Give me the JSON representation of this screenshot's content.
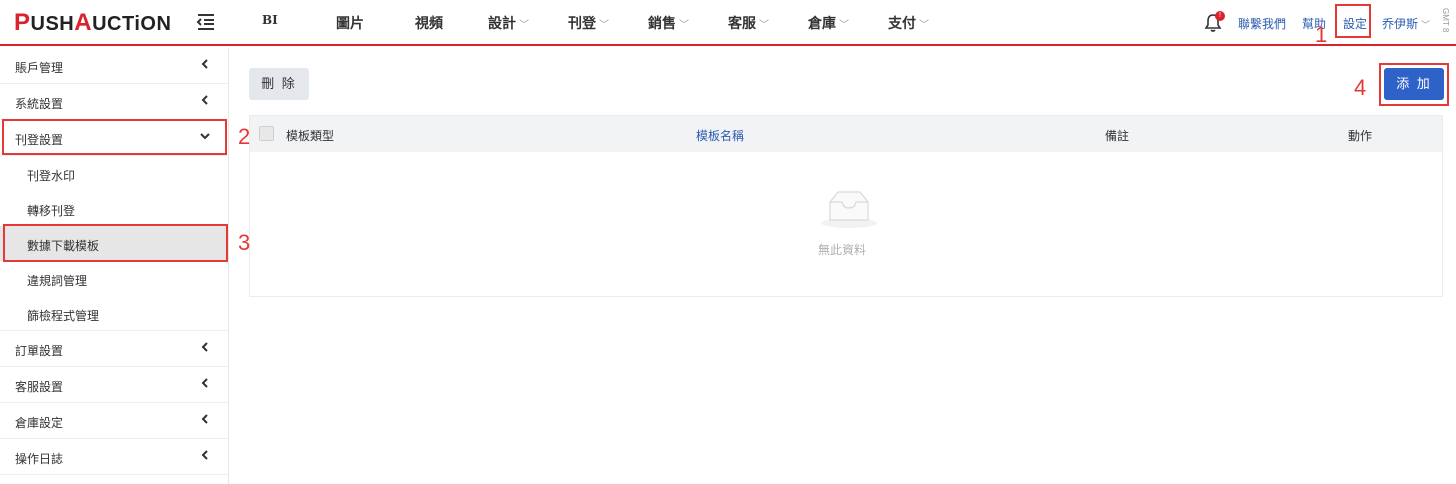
{
  "logo": {
    "first_cap": "P",
    "first_rest": "USH",
    "second_cap": "A",
    "second_rest": "UCTiON"
  },
  "nav": {
    "items": [
      {
        "label": "BI",
        "dropdown": false
      },
      {
        "label": "圖片",
        "dropdown": false
      },
      {
        "label": "視頻",
        "dropdown": false
      },
      {
        "label": "設計",
        "dropdown": true
      },
      {
        "label": "刊登",
        "dropdown": true
      },
      {
        "label": "銷售",
        "dropdown": true
      },
      {
        "label": "客服",
        "dropdown": true
      },
      {
        "label": "倉庫",
        "dropdown": true
      },
      {
        "label": "支付",
        "dropdown": true
      }
    ],
    "notification_badge": "!",
    "contact": "聯繫我們",
    "help": "幫助",
    "settings": "設定",
    "user": "乔伊斯",
    "timezone": "GMT 8"
  },
  "sidebar": {
    "items": [
      {
        "label": "賬戶管理"
      },
      {
        "label": "系統設置"
      },
      {
        "label": "刊登設置"
      },
      {
        "label": "訂單設置"
      },
      {
        "label": "客服設置"
      },
      {
        "label": "倉庫設定"
      },
      {
        "label": "操作日誌"
      }
    ],
    "sub_items": [
      {
        "label": "刊登水印"
      },
      {
        "label": "轉移刊登"
      },
      {
        "label": "數據下載模板"
      },
      {
        "label": "違規詞管理"
      },
      {
        "label": "篩檢程式管理"
      }
    ]
  },
  "toolbar": {
    "delete_label": "刪 除",
    "add_label": "添 加"
  },
  "table": {
    "columns": [
      "模板類型",
      "模板名稱",
      "備註",
      "動作"
    ],
    "empty_text": "無此資料"
  },
  "steps": [
    "1",
    "2",
    "3",
    "4"
  ],
  "colors": {
    "brand_red": "#d9232d",
    "primary_blue": "#2f62c9",
    "highlight_red": "#e53935",
    "link_blue": "#2a5db0"
  }
}
